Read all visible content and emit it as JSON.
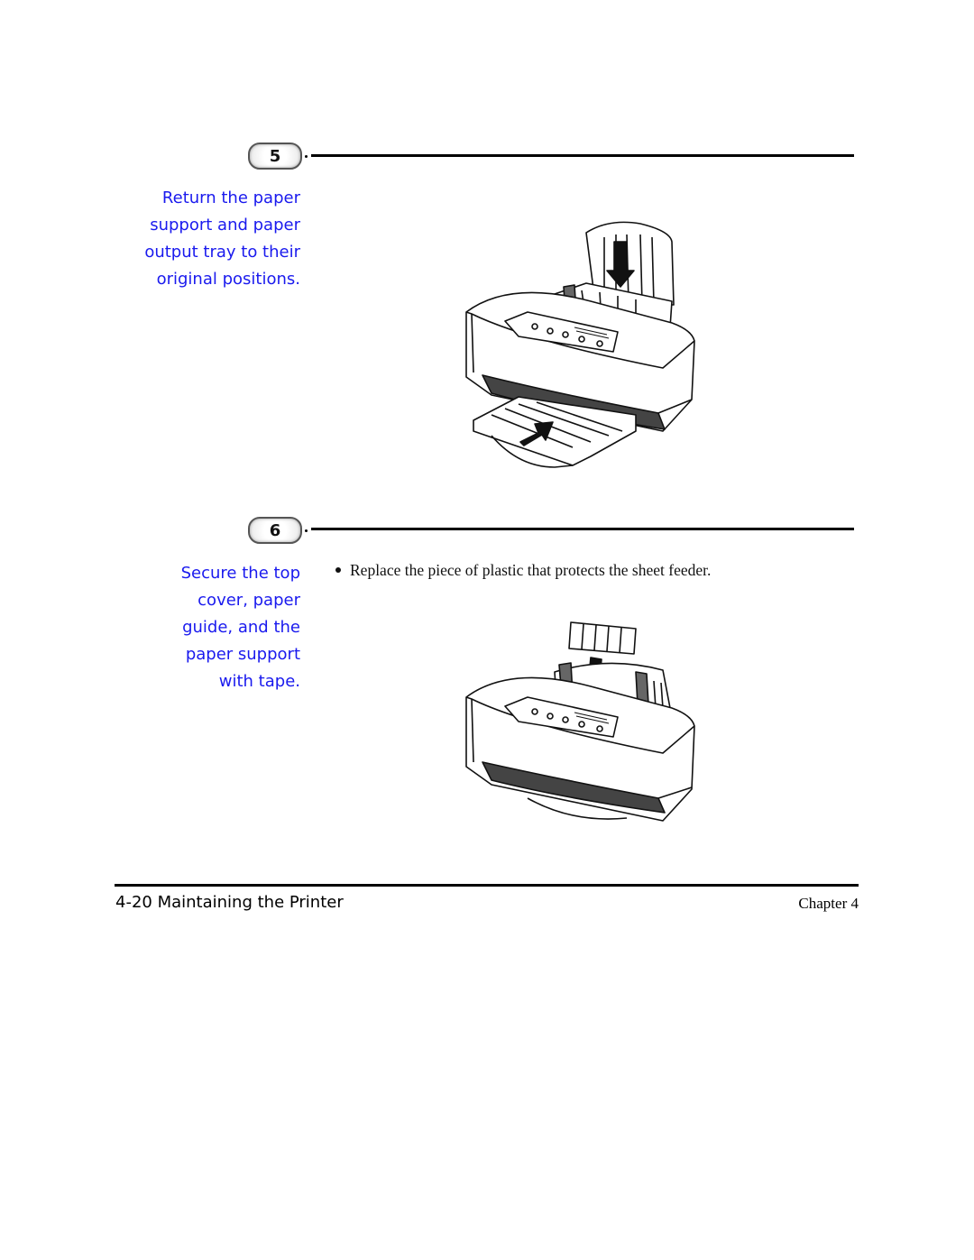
{
  "steps": [
    {
      "number": "5",
      "caption_lines": [
        "Return the paper",
        "support and paper",
        "output tray to their",
        "original positions."
      ],
      "illustration": "printer-paper-support-output-tray-illustration"
    },
    {
      "number": "6",
      "caption_lines": [
        "Secure the top",
        "cover, paper",
        "guide, and the",
        "paper support",
        "with tape."
      ],
      "bullets": [
        "Replace the piece of plastic that protects the sheet feeder."
      ],
      "illustration": "printer-sheet-feeder-cover-illustration"
    }
  ],
  "footer": {
    "page_title": "4-20 Maintaining the Printer",
    "chapter": "Chapter 4"
  },
  "colors": {
    "caption": "#1a1aee",
    "text": "#111111"
  }
}
